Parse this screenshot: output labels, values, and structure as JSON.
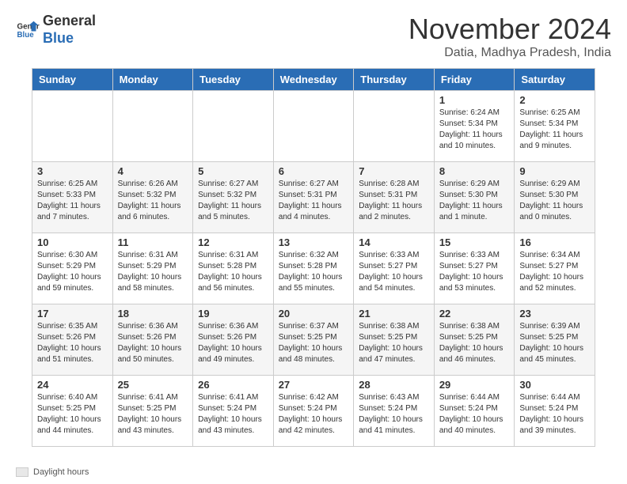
{
  "header": {
    "logo_line1": "General",
    "logo_line2": "Blue",
    "month_title": "November 2024",
    "location": "Datia, Madhya Pradesh, India"
  },
  "weekdays": [
    "Sunday",
    "Monday",
    "Tuesday",
    "Wednesday",
    "Thursday",
    "Friday",
    "Saturday"
  ],
  "legend": {
    "label": "Daylight hours"
  },
  "weeks": [
    [
      {
        "day": "",
        "info": ""
      },
      {
        "day": "",
        "info": ""
      },
      {
        "day": "",
        "info": ""
      },
      {
        "day": "",
        "info": ""
      },
      {
        "day": "",
        "info": ""
      },
      {
        "day": "1",
        "info": "Sunrise: 6:24 AM\nSunset: 5:34 PM\nDaylight: 11 hours and 10 minutes."
      },
      {
        "day": "2",
        "info": "Sunrise: 6:25 AM\nSunset: 5:34 PM\nDaylight: 11 hours and 9 minutes."
      }
    ],
    [
      {
        "day": "3",
        "info": "Sunrise: 6:25 AM\nSunset: 5:33 PM\nDaylight: 11 hours and 7 minutes."
      },
      {
        "day": "4",
        "info": "Sunrise: 6:26 AM\nSunset: 5:32 PM\nDaylight: 11 hours and 6 minutes."
      },
      {
        "day": "5",
        "info": "Sunrise: 6:27 AM\nSunset: 5:32 PM\nDaylight: 11 hours and 5 minutes."
      },
      {
        "day": "6",
        "info": "Sunrise: 6:27 AM\nSunset: 5:31 PM\nDaylight: 11 hours and 4 minutes."
      },
      {
        "day": "7",
        "info": "Sunrise: 6:28 AM\nSunset: 5:31 PM\nDaylight: 11 hours and 2 minutes."
      },
      {
        "day": "8",
        "info": "Sunrise: 6:29 AM\nSunset: 5:30 PM\nDaylight: 11 hours and 1 minute."
      },
      {
        "day": "9",
        "info": "Sunrise: 6:29 AM\nSunset: 5:30 PM\nDaylight: 11 hours and 0 minutes."
      }
    ],
    [
      {
        "day": "10",
        "info": "Sunrise: 6:30 AM\nSunset: 5:29 PM\nDaylight: 10 hours and 59 minutes."
      },
      {
        "day": "11",
        "info": "Sunrise: 6:31 AM\nSunset: 5:29 PM\nDaylight: 10 hours and 58 minutes."
      },
      {
        "day": "12",
        "info": "Sunrise: 6:31 AM\nSunset: 5:28 PM\nDaylight: 10 hours and 56 minutes."
      },
      {
        "day": "13",
        "info": "Sunrise: 6:32 AM\nSunset: 5:28 PM\nDaylight: 10 hours and 55 minutes."
      },
      {
        "day": "14",
        "info": "Sunrise: 6:33 AM\nSunset: 5:27 PM\nDaylight: 10 hours and 54 minutes."
      },
      {
        "day": "15",
        "info": "Sunrise: 6:33 AM\nSunset: 5:27 PM\nDaylight: 10 hours and 53 minutes."
      },
      {
        "day": "16",
        "info": "Sunrise: 6:34 AM\nSunset: 5:27 PM\nDaylight: 10 hours and 52 minutes."
      }
    ],
    [
      {
        "day": "17",
        "info": "Sunrise: 6:35 AM\nSunset: 5:26 PM\nDaylight: 10 hours and 51 minutes."
      },
      {
        "day": "18",
        "info": "Sunrise: 6:36 AM\nSunset: 5:26 PM\nDaylight: 10 hours and 50 minutes."
      },
      {
        "day": "19",
        "info": "Sunrise: 6:36 AM\nSunset: 5:26 PM\nDaylight: 10 hours and 49 minutes."
      },
      {
        "day": "20",
        "info": "Sunrise: 6:37 AM\nSunset: 5:25 PM\nDaylight: 10 hours and 48 minutes."
      },
      {
        "day": "21",
        "info": "Sunrise: 6:38 AM\nSunset: 5:25 PM\nDaylight: 10 hours and 47 minutes."
      },
      {
        "day": "22",
        "info": "Sunrise: 6:38 AM\nSunset: 5:25 PM\nDaylight: 10 hours and 46 minutes."
      },
      {
        "day": "23",
        "info": "Sunrise: 6:39 AM\nSunset: 5:25 PM\nDaylight: 10 hours and 45 minutes."
      }
    ],
    [
      {
        "day": "24",
        "info": "Sunrise: 6:40 AM\nSunset: 5:25 PM\nDaylight: 10 hours and 44 minutes."
      },
      {
        "day": "25",
        "info": "Sunrise: 6:41 AM\nSunset: 5:25 PM\nDaylight: 10 hours and 43 minutes."
      },
      {
        "day": "26",
        "info": "Sunrise: 6:41 AM\nSunset: 5:24 PM\nDaylight: 10 hours and 43 minutes."
      },
      {
        "day": "27",
        "info": "Sunrise: 6:42 AM\nSunset: 5:24 PM\nDaylight: 10 hours and 42 minutes."
      },
      {
        "day": "28",
        "info": "Sunrise: 6:43 AM\nSunset: 5:24 PM\nDaylight: 10 hours and 41 minutes."
      },
      {
        "day": "29",
        "info": "Sunrise: 6:44 AM\nSunset: 5:24 PM\nDaylight: 10 hours and 40 minutes."
      },
      {
        "day": "30",
        "info": "Sunrise: 6:44 AM\nSunset: 5:24 PM\nDaylight: 10 hours and 39 minutes."
      }
    ]
  ]
}
